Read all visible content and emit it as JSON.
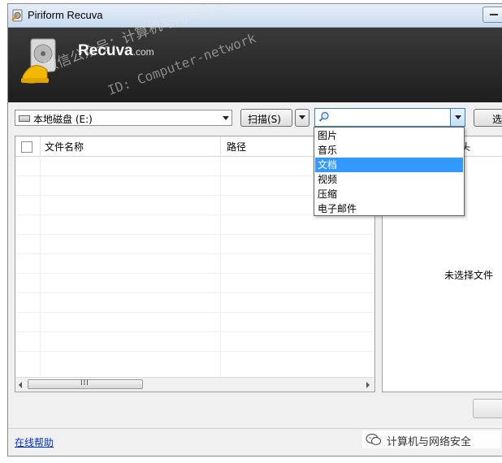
{
  "window": {
    "title": "Piriform Recuva"
  },
  "banner": {
    "brand": "Recuva",
    "brand_suffix": ".com",
    "watermark_line1": "微信公众号：计算机与网络安全",
    "watermark_line2": "ID: Computer-network"
  },
  "toolbar": {
    "drive_select": "本地磁盘 (E:)",
    "scan_label": "扫描(S)",
    "filter_value": "",
    "options_label": "选"
  },
  "filter_dropdown": {
    "options": [
      "图片",
      "音乐",
      "文档",
      "视频",
      "压缩",
      "电子邮件"
    ],
    "selected": "文档"
  },
  "file_list": {
    "columns": [
      "文件名称",
      "路径"
    ],
    "scroll_grip": "III"
  },
  "right_panel": {
    "tab_label": "头",
    "empty_message": "未选择文件"
  },
  "status": {
    "help_link": "在线帮助",
    "wechat_label": "计算机与网络安全"
  }
}
